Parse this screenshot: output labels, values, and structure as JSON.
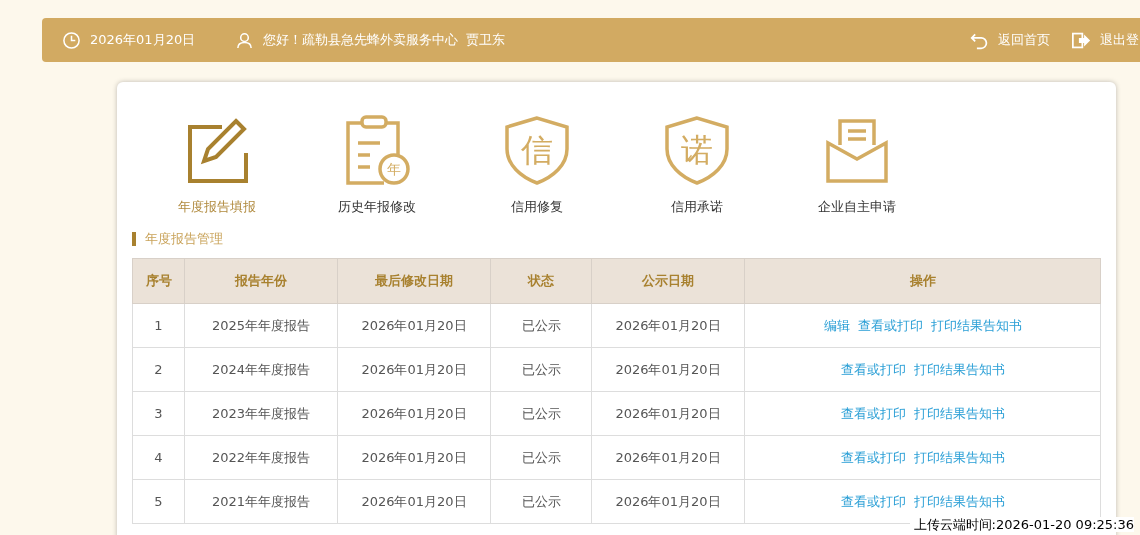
{
  "header": {
    "date": "2026年01月20日",
    "greeting": "您好！疏勒县急先蜂外卖服务中心  贾卫东",
    "links": [
      {
        "kind": "home",
        "label": "返回首页"
      },
      {
        "kind": "logout",
        "label": "退出登"
      }
    ]
  },
  "tiles": [
    {
      "kind": "edit",
      "label": "年度报告填报",
      "selected": true
    },
    {
      "kind": "history",
      "label": "历史年报修改",
      "glyph": "年",
      "selected": false
    },
    {
      "kind": "shield",
      "label": "信用修复",
      "glyph": "信",
      "selected": false
    },
    {
      "kind": "shield",
      "label": "信用承诺",
      "glyph": "诺",
      "selected": false
    },
    {
      "kind": "mail",
      "label": "企业自主申请",
      "selected": false
    }
  ],
  "section_title": "年度报告管理",
  "table": {
    "columns": [
      "序号",
      "报告年份",
      "最后修改日期",
      "状态",
      "公示日期",
      "操作"
    ],
    "rows": [
      {
        "cells": [
          "1",
          "2025年年度报告",
          "2026年01月20日",
          "已公示",
          "2026年01月20日"
        ],
        "actions": [
          "编辑",
          "查看或打印",
          "打印结果告知书"
        ]
      },
      {
        "cells": [
          "2",
          "2024年年度报告",
          "2026年01月20日",
          "已公示",
          "2026年01月20日"
        ],
        "actions": [
          "查看或打印",
          "打印结果告知书"
        ]
      },
      {
        "cells": [
          "3",
          "2023年年度报告",
          "2026年01月20日",
          "已公示",
          "2026年01月20日"
        ],
        "actions": [
          "查看或打印",
          "打印结果告知书"
        ]
      },
      {
        "cells": [
          "4",
          "2022年年度报告",
          "2026年01月20日",
          "已公示",
          "2026年01月20日"
        ],
        "actions": [
          "查看或打印",
          "打印结果告知书"
        ]
      },
      {
        "cells": [
          "5",
          "2021年年度报告",
          "2026年01月20日",
          "已公示",
          "2026年01月20日"
        ],
        "actions": [
          "查看或打印",
          "打印结果告知书"
        ]
      }
    ]
  },
  "upload_time": "上传云端时间:2026-01-20 09:25:36"
}
